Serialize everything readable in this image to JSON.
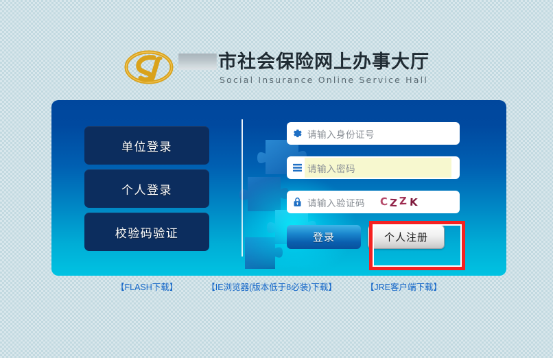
{
  "header": {
    "logo_text": "CSI",
    "logo_icon": "csi-emblem-icon",
    "title_cn": "市社会保险网上办事大厅",
    "title_en": "Social Insurance Online Service Hall",
    "redacted_segment": ""
  },
  "nav": {
    "buttons": [
      {
        "label": "单位登录",
        "name": "unit-login"
      },
      {
        "label": "个人登录",
        "name": "personal-login"
      },
      {
        "label": "校验码验证",
        "name": "verification-code-check"
      }
    ]
  },
  "form": {
    "id_field": {
      "placeholder": "请输入身份证号",
      "value": "",
      "icon": "gear-icon"
    },
    "password_field": {
      "placeholder": "请输入密码",
      "value": "",
      "icon": "list-icon"
    },
    "captcha_field": {
      "placeholder": "请输入验证码",
      "value": "",
      "icon": "lock-icon"
    },
    "captcha_code": "CZZK",
    "captcha_chars": [
      "C",
      "Z",
      "Z",
      "K"
    ],
    "login_label": "登录",
    "register_label": "个人注册"
  },
  "footer": {
    "links": [
      {
        "label": "【FLASH下载】",
        "name": "flash-download"
      },
      {
        "label": "【IE浏览器(版本低于8必装)下载】",
        "name": "ie-browser-download"
      },
      {
        "label": "【JRE客户端下载】",
        "name": "jre-client-download"
      }
    ]
  },
  "colors": {
    "panel_top": "#00479d",
    "panel_bottom": "#00c3e2",
    "nav_button": "#0c2d5e",
    "annotation_red": "#f52121",
    "link_blue": "#1466c8",
    "autofill_yellow": "#f7f8cf",
    "captcha_red": "#a8305a",
    "logo_gold": "#d9a21b",
    "page_bg": "#c2d9e0"
  }
}
